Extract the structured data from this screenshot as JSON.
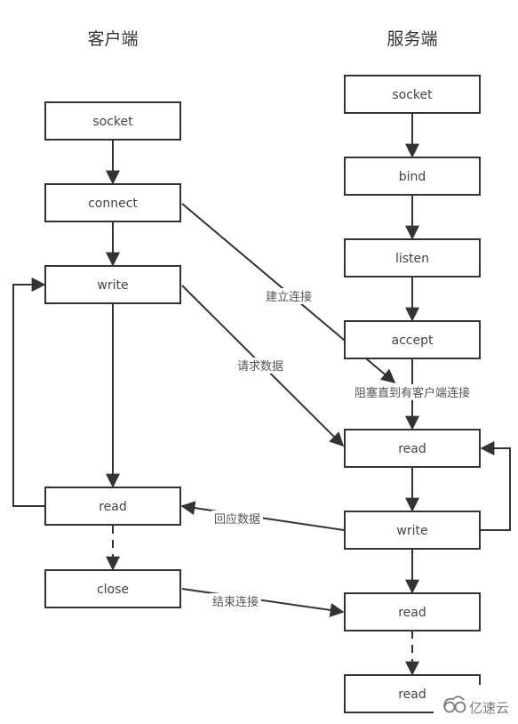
{
  "titles": {
    "client": "客户端",
    "server": "服务端"
  },
  "client_nodes": {
    "socket": "socket",
    "connect": "connect",
    "write": "write",
    "read": "read",
    "close": "close"
  },
  "server_nodes": {
    "socket": "socket",
    "bind": "bind",
    "listen": "listen",
    "accept": "accept",
    "read1": "read",
    "write": "write",
    "read2": "read",
    "read3": "read"
  },
  "edge_labels": {
    "establish_connection": "建立连接",
    "request_data": "请求数据",
    "block_until_client": "阻塞直到有客户端连接",
    "respond_data": "回应数据",
    "end_connection": "结束连接"
  },
  "watermark": {
    "text": "亿速云",
    "icon": "cloud-logo-icon"
  }
}
